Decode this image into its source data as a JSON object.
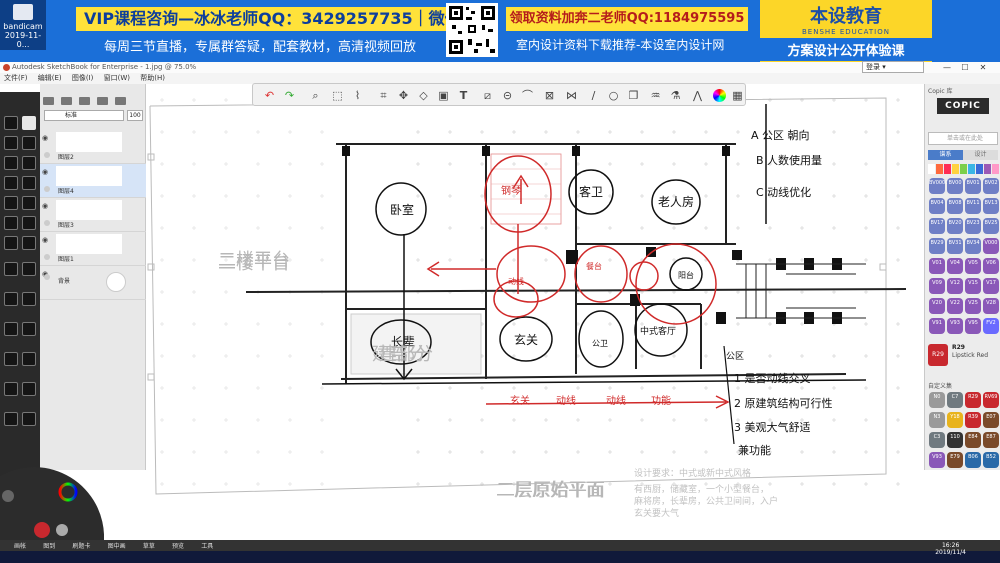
{
  "recorder": {
    "name": "bandicam",
    "date": "2019-11-0..."
  },
  "banner": {
    "vip_text": "VIP课程咨询—冰冰老师QQ：3429257735｜微信",
    "live_text": "每周三节直播，专属群答疑，配套教材，高清视频回放",
    "qq2_text": "领取资料加奔二老师QQ:1184975595",
    "download_text": "室内设计资料下载推荐-本设室内设计网",
    "brand_cn": "本设教育",
    "brand_en": "BENSHE EDUCATION",
    "brand_sub": "方案设计公开体验课"
  },
  "window": {
    "title": "Autodesk SketchBook for Enterprise - 1.jpg @ 75.0%",
    "user_menu": "登录",
    "controls": [
      "—",
      "☐",
      "✕"
    ]
  },
  "menu": [
    "文件(F)",
    "编辑(E)",
    "图像(I)",
    "窗口(W)",
    "帮助(H)"
  ],
  "layers": {
    "blend_mode": "标准",
    "opacity": "100",
    "items": [
      {
        "name": "图层2",
        "selected": false
      },
      {
        "name": "图层4",
        "selected": true
      },
      {
        "name": "图层3",
        "selected": false
      },
      {
        "name": "图层1",
        "selected": false
      },
      {
        "name": "背景",
        "selected": false
      }
    ]
  },
  "plan": {
    "room_labels": [
      "二楼平台",
      "建部分",
      "二层原始平面"
    ],
    "requirements_title": "设计要求：中式或新中式风格",
    "requirements_body": "有西厨，储藏室，一个小型餐台，\n麻将房，长辈房，公共卫间间，入户\n玄关要大气"
  },
  "copic": {
    "header": "Copic 库",
    "logo": "COPIC",
    "search_placeholder": "单击或在此处",
    "tab_group": "谱系",
    "tab_set": "设计",
    "swatches_row1": [
      "#ffffff",
      "#ff6a3d",
      "#ff2d55",
      "#ffd23f",
      "#7ccf4a",
      "#3bb6e5",
      "#3a6bd8",
      "#9b59b6",
      "#ff9ac8"
    ],
    "grid": [
      [
        "BV0000",
        "BV00",
        "BV01",
        "BV02"
      ],
      [
        "BV04",
        "BV08",
        "BV11",
        "BV13"
      ],
      [
        "BV17",
        "BV20",
        "BV23",
        "BV25"
      ],
      [
        "BV29",
        "BV31",
        "BV34",
        "V000"
      ],
      [
        "V01",
        "V04",
        "V05",
        "V06"
      ],
      [
        "V09",
        "V12",
        "V15",
        "V17"
      ],
      [
        "V20",
        "V22",
        "V25",
        "V28"
      ],
      [
        "V91",
        "V93",
        "V95",
        "FV2"
      ]
    ],
    "current_code": "R29",
    "current_name": "Lipstick Red",
    "current_color": "#c8282e",
    "custom_label": "自定义集",
    "custom_grid": [
      [
        "N0",
        "C7",
        "R29",
        "RV69"
      ],
      [
        "N3",
        "Y18",
        "R39",
        "E07"
      ],
      [
        "C3",
        "110",
        "E84",
        "E87"
      ],
      [
        "V93",
        "E79",
        "B06",
        "B52"
      ]
    ]
  },
  "bottom_tabs": [
    "画帐",
    "图到",
    "刷题卡",
    "图中画",
    "草草",
    "预览",
    "工具"
  ],
  "clock": {
    "time": "16:26",
    "date": "2019/11/4"
  }
}
